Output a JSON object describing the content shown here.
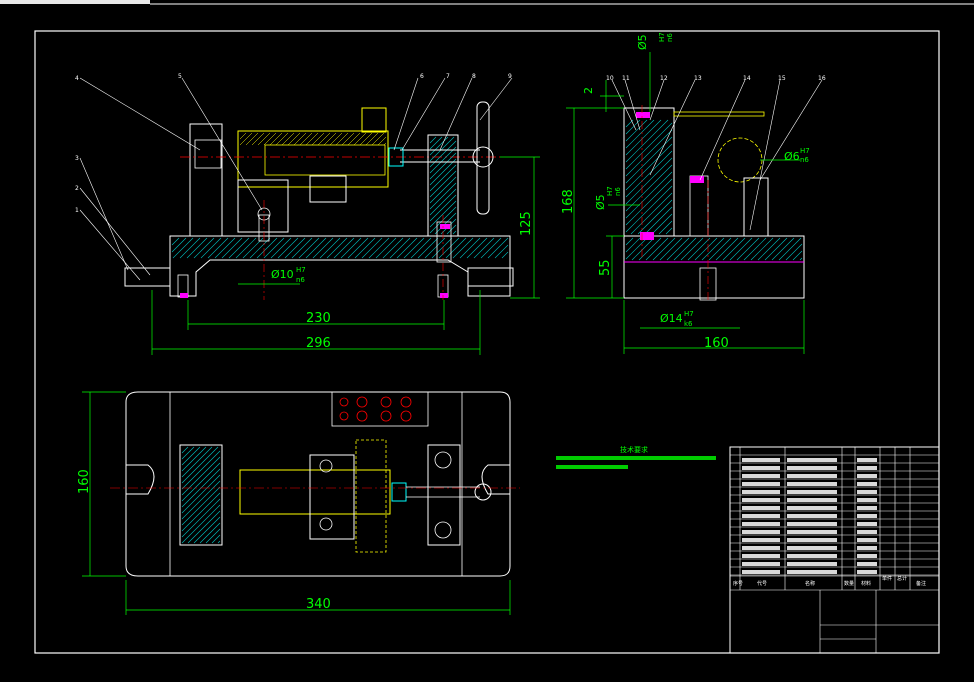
{
  "colors": {
    "background": "#000000",
    "outline": "#ffffff",
    "dimension": "#00ff00",
    "hatch": "#00bfbf",
    "part_yellow": "#ffff00",
    "centerline": "#ff0000",
    "accent_magenta": "#ff00ff"
  },
  "front_view": {
    "dim_230": "230",
    "dim_296": "296",
    "dim_125": "125",
    "dia_10": "Ø10",
    "dia_10_tol_upper": "H7",
    "dia_10_tol_lower": "n6"
  },
  "side_view": {
    "dim_168": "168",
    "dim_55": "55",
    "dim_2": "2",
    "dim_160": "160",
    "dia_5a": "Ø5",
    "dia_5a_tol_upper": "H7",
    "dia_5a_tol_lower": "n6",
    "dia_5b": "Ø5",
    "dia_5b_tol_upper": "H7",
    "dia_5b_tol_lower": "n6",
    "dia_6": "Ø6",
    "dia_6_tol_upper": "H7",
    "dia_6_tol_lower": "n6",
    "dia_14": "Ø14",
    "dia_14_tol_upper": "H7",
    "dia_14_tol_lower": "k6"
  },
  "top_view": {
    "dim_160": "160",
    "dim_340": "340"
  },
  "balloons": {
    "left": [
      "4",
      "3",
      "2",
      "1"
    ],
    "top": [
      "5",
      "6",
      "7",
      "8",
      "9"
    ],
    "side": [
      "10",
      "11",
      "12",
      "13",
      "14",
      "15",
      "16"
    ]
  },
  "notes": {
    "title": "技术要求"
  },
  "title_block": {
    "header_labels": [
      "序号",
      "代号",
      "名称",
      "数量",
      "材料",
      "单件",
      "总计",
      "备注"
    ]
  }
}
